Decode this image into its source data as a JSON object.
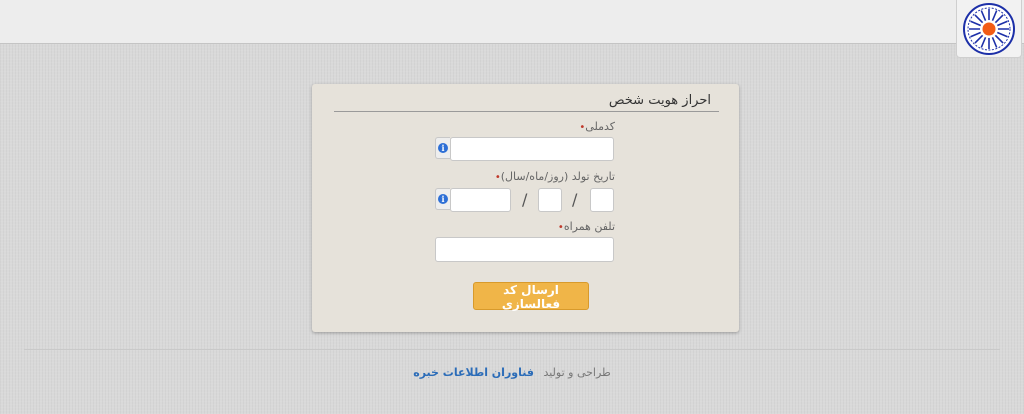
{
  "header": {
    "logo_icon": "university-emblem-icon"
  },
  "form": {
    "title": "احراز هویت شخص",
    "national_code": {
      "label": "کدملی",
      "value": "",
      "placeholder": ""
    },
    "birth_date": {
      "label": "تاریخ تولد (روز/ماه/سال)",
      "separator": "/",
      "year": "",
      "month": "",
      "day": ""
    },
    "mobile": {
      "label": "تلفن همراه",
      "value": ""
    },
    "required_marker": "•",
    "info_icon": "info-icon",
    "submit_label": "ارسال کد فعالسازی"
  },
  "footer": {
    "prefix": "طراحی و تولید",
    "company": "فناوران اطلاعات خبره"
  },
  "colors": {
    "accent_button": "#f0b548",
    "link": "#2b6cb8",
    "required": "#c0392b",
    "info": "#2d6fd6"
  }
}
